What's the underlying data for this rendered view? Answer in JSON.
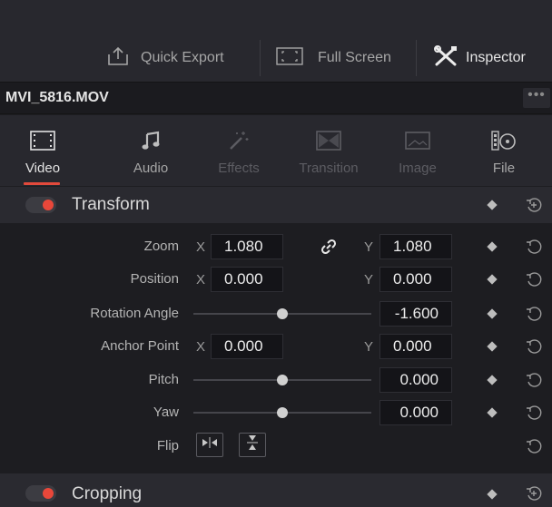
{
  "toolbar": {
    "quick_export": "Quick Export",
    "full_screen": "Full Screen",
    "inspector": "Inspector"
  },
  "file": {
    "name": "MVI_5816.MOV",
    "more": "•••"
  },
  "tabs": [
    {
      "label": "Video",
      "icon": "film-icon",
      "state": "active"
    },
    {
      "label": "Audio",
      "icon": "music-note-icon",
      "state": "normal"
    },
    {
      "label": "Effects",
      "icon": "magic-wand-icon",
      "state": "disabled"
    },
    {
      "label": "Transition",
      "icon": "transition-icon",
      "state": "disabled"
    },
    {
      "label": "Image",
      "icon": "image-icon",
      "state": "disabled"
    },
    {
      "label": "File",
      "icon": "file-reels-icon",
      "state": "normal"
    }
  ],
  "transform": {
    "title": "Transform",
    "enabled": true,
    "zoom": {
      "label": "Zoom",
      "x_axis": "X",
      "x": "1.080",
      "y_axis": "Y",
      "y": "1.080"
    },
    "position": {
      "label": "Position",
      "x_axis": "X",
      "x": "0.000",
      "y_axis": "Y",
      "y": "0.000"
    },
    "rotation": {
      "label": "Rotation Angle",
      "value": "-1.600",
      "slider_fraction": 0.5
    },
    "anchor": {
      "label": "Anchor Point",
      "x_axis": "X",
      "x": "0.000",
      "y_axis": "Y",
      "y": "0.000"
    },
    "pitch": {
      "label": "Pitch",
      "value": "0.000",
      "slider_fraction": 0.5
    },
    "yaw": {
      "label": "Yaw",
      "value": "0.000",
      "slider_fraction": 0.5
    },
    "flip": {
      "label": "Flip"
    }
  },
  "cropping": {
    "title": "Cropping",
    "enabled": true
  },
  "colors": {
    "accent": "#e8473a",
    "panel": "#28282e",
    "background": "#1d1d21"
  }
}
